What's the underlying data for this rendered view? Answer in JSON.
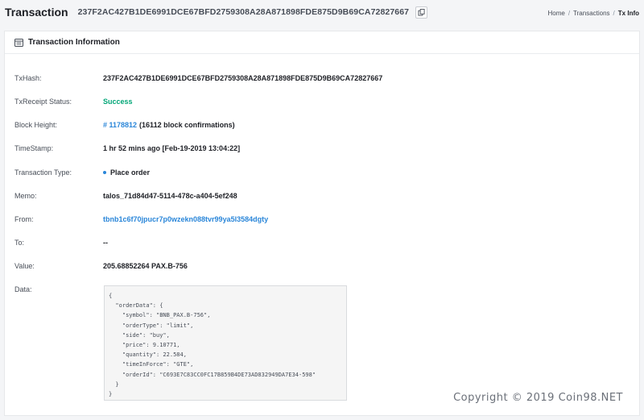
{
  "header": {
    "title": "Transaction",
    "hash": "237F2AC427B1DE6991DCE67BFD2759308A28A871898FDE875D9B69CA72827667",
    "copy_icon": "copy-icon"
  },
  "breadcrumb": {
    "items": [
      "Home",
      "Transactions",
      "Tx Info"
    ],
    "separator": "/"
  },
  "card": {
    "title": "Transaction Information",
    "icon": "list-icon"
  },
  "fields": {
    "txhash": {
      "label": "TxHash:",
      "value": "237F2AC427B1DE6991DCE67BFD2759308A28A871898FDE875D9B69CA72827667"
    },
    "status": {
      "label": "TxReceipt Status:",
      "value": "Success"
    },
    "block": {
      "label": "Block Height:",
      "link": "# 1178812",
      "extra": "(16112 block confirmations)"
    },
    "timestamp": {
      "label": "TimeStamp:",
      "value": "1 hr 52 mins ago [Feb-19-2019 13:04:22]"
    },
    "type": {
      "label": "Transaction Type:",
      "value": "Place order"
    },
    "memo": {
      "label": "Memo:",
      "value": "talos_71d84d47-5114-478c-a404-5ef248"
    },
    "from": {
      "label": "From:",
      "value": "tbnb1c6f70jpucr7p0wzekn088tvr99ya5l3584dgty"
    },
    "to": {
      "label": "To:",
      "value": "--"
    },
    "amount": {
      "label": "Value:",
      "value": "205.68852264 PAX.B-756"
    },
    "data": {
      "label": "Data:",
      "code": "{\n  \"orderData\": {\n    \"symbol\": \"BNB_PAX.B-756\",\n    \"orderType\": \"limit\",\n    \"side\": \"buy\",\n    \"price\": 9.10771,\n    \"quantity\": 22.584,\n    \"timeInForce\": \"GTE\",\n    \"orderId\": \"C693E7C83CC0FC17B859B4DE73AD832949DA7E34-598\"\n  }\n}"
    }
  },
  "watermark": "Copyright © 2019 Coin98.NET",
  "colors": {
    "success": "#02a677",
    "link": "#2a86d9"
  }
}
